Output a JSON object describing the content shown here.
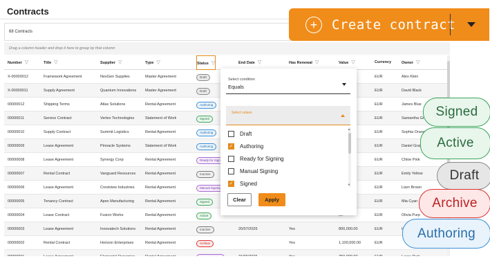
{
  "page": {
    "title": "Contracts",
    "count_text": "68 Contracts",
    "group_hint": "Drag a column header and drop it here to group by that column"
  },
  "create_button": {
    "label": "Create contract"
  },
  "columns": [
    "Number",
    "Title",
    "Supplier",
    "Type",
    "Status",
    "End Date",
    "Has Renewal",
    "Value",
    "Currency",
    "Owner"
  ],
  "rows": [
    {
      "number": "X-00000012",
      "title": "Framework Agreement",
      "supplier": "NexGen Supplies",
      "type": "Master Agreement",
      "status": "Draft",
      "end": "",
      "renewal": "",
      "value": "57",
      "currency": "EUR",
      "owner": "Alex Klein"
    },
    {
      "number": "X-00000011",
      "title": "Supply Agreement",
      "supplier": "Quantum Innovations",
      "type": "Master Agreement",
      "status": "Draft",
      "end": "",
      "renewal": "",
      "value": "10",
      "currency": "EUR",
      "owner": "David Black"
    },
    {
      "number": "00000012",
      "title": "Shipping Terms",
      "supplier": "Atlas Solutions",
      "type": "Rental Agreement",
      "status": "Authoring",
      "end": "",
      "renewal": "",
      "value": "99",
      "currency": "EUR",
      "owner": "James Blue"
    },
    {
      "number": "00000011",
      "title": "Service Contract",
      "supplier": "Vertex Technologies",
      "type": "Statement of Work",
      "status": "Signed",
      "end": "",
      "renewal": "",
      "value": "00",
      "currency": "EUR",
      "owner": "Samantha Gr"
    },
    {
      "number": "00000010",
      "title": "Supply Contract",
      "supplier": "Summit Logistics",
      "type": "Rental Agreement",
      "status": "Authoring",
      "end": "",
      "renewal": "",
      "value": ".00",
      "currency": "EUR",
      "owner": "Sophia Orange"
    },
    {
      "number": "00000009",
      "title": "Lease Agreement",
      "supplier": "Pinnacle Systems",
      "type": "Statement of Work",
      "status": "Authoring",
      "end": "",
      "renewal": "",
      "value": "00",
      "currency": "EUR",
      "owner": "Daniel Gray"
    },
    {
      "number": "00000008",
      "title": "Lease Agreement",
      "supplier": "Synergy Corp",
      "type": "Rental Agreement",
      "status": "Ready for Signing",
      "end": "",
      "renewal": "",
      "value": "00",
      "currency": "EUR",
      "owner": "Chloe Pink"
    },
    {
      "number": "00000007",
      "title": "Rental Contract",
      "supplier": "Vanguard Resources",
      "type": "Rental Agreement",
      "status": "Inactive",
      "end": "",
      "renewal": "",
      "value": ".00",
      "currency": "EUR",
      "owner": "Emily Yellow"
    },
    {
      "number": "00000006",
      "title": "Lease Agreement",
      "supplier": "Crestview Industries",
      "type": "Rental Agreement",
      "status": "Manual Signing",
      "end": "",
      "renewal": "",
      "value": ".00",
      "currency": "EUR",
      "owner": "Liam Brown"
    },
    {
      "number": "00000005",
      "title": "Tenancy Contract",
      "supplier": "Apex Manufacturing",
      "type": "Rental Agreement",
      "status": "Signed",
      "end": "",
      "renewal": "",
      "value": ".00",
      "currency": "EUR",
      "owner": "Mia Cyan"
    },
    {
      "number": "00000004",
      "title": "Lease Contract",
      "supplier": "Fusion Works",
      "type": "Rental Agreement",
      "status": "Active",
      "end": "",
      "renewal": "",
      "value": "99",
      "currency": "EUR",
      "owner": "Olivia Purp"
    },
    {
      "number": "00000003",
      "title": "Lease Agreement",
      "supplier": "Innovatech Solutions",
      "type": "Rental Agreement",
      "status": "Inactive",
      "end": "20/07/2026",
      "renewal": "Yes",
      "value": "800,000.00",
      "currency": "EUR",
      "owner": "Is"
    },
    {
      "number": "00000002",
      "title": "Rental Contract",
      "supplier": "Horizon Enterprises",
      "type": "Rental Agreement",
      "status": "Archive",
      "end": "",
      "renewal": "Yes",
      "value": "1,100,000.00",
      "currency": "EUR",
      "owner": ""
    },
    {
      "number": "00000001",
      "title": "Lease Agreement",
      "supplier": "Elemental Dynamico",
      "type": "Rental Agreement",
      "status": "Manual Signing",
      "end": "15/06/2026",
      "renewal": "Yes",
      "value": "750,000.00",
      "currency": "EUR",
      "owner": "Laura Red"
    }
  ],
  "filter": {
    "condition_label": "Select condition",
    "condition_value": "Equals",
    "values_label": "Select values",
    "options": [
      {
        "label": "Draft",
        "checked": false
      },
      {
        "label": "Authoring",
        "checked": true
      },
      {
        "label": "Ready for Signing",
        "checked": false
      },
      {
        "label": "Manual Signing",
        "checked": false
      },
      {
        "label": "Signed",
        "checked": true
      }
    ],
    "clear_label": "Clear",
    "apply_label": "Apply"
  },
  "status_callouts": [
    "Signed",
    "Active",
    "Draft",
    "Archive",
    "Authoring"
  ],
  "colors": {
    "accent": "#f08c1a",
    "signed": "#3aa55a",
    "authoring": "#3a8ed6",
    "archive": "#dd3333",
    "draft": "#888888"
  }
}
